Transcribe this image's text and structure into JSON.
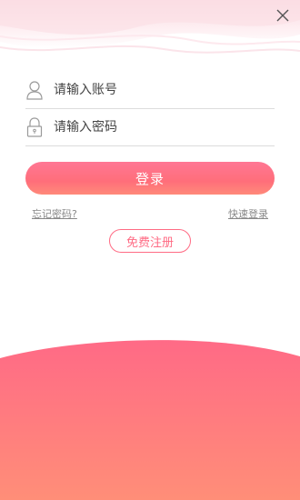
{
  "header": {
    "close_icon": "close-icon"
  },
  "form": {
    "account_placeholder": "请输入账号",
    "password_placeholder": "请输入密码",
    "account_icon": "user-icon",
    "password_icon": "lock-icon"
  },
  "actions": {
    "login_label": "登录",
    "forgot_label": "忘记密码?",
    "quick_login_label": "快速登录",
    "register_label": "免费注册"
  },
  "colors": {
    "accent": "#ff6b84",
    "gradient_top": "#ff6a86",
    "gradient_bottom": "#ff8e78",
    "top_wave_tint": "#fde3e9"
  }
}
